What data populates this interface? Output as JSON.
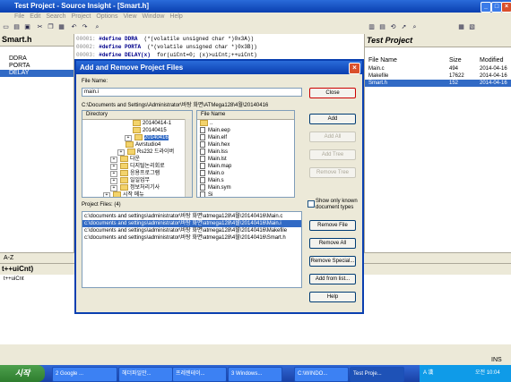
{
  "window": {
    "title": "Test Project - Source Insight - [Smart.h]"
  },
  "menu": [
    "File",
    "Edit",
    "Search",
    "Project",
    "Options",
    "View",
    "Window",
    "Help"
  ],
  "left_pane": {
    "title": "Smart.h",
    "symbols": [
      "DDRA",
      "PORTA",
      "DELAY"
    ],
    "selected": 2
  },
  "editor": {
    "lines": [
      {
        "num": "00001:",
        "kw": "#define",
        "name": "DDRA",
        "rest": "(*(volatile unsigned char *)0x3A))"
      },
      {
        "num": "00002:",
        "kw": "#define",
        "name": "PORTA",
        "rest": "(*(volatile unsigned char *)0x3B))"
      },
      {
        "num": "00003:",
        "kw": "#define",
        "name": "DELAY(x)",
        "rest": "for(uiCnt=0; (x)>uiCnt;++uiCnt)"
      }
    ]
  },
  "project_pane": {
    "title": "Test Project",
    "columns": [
      "File Name",
      "Size",
      "Modified"
    ],
    "files": [
      {
        "name": "Main.c",
        "size": "494",
        "modified": "2014-04-16"
      },
      {
        "name": "Makefile",
        "size": "17622",
        "modified": "2014-04-16"
      },
      {
        "name": "Smart.h",
        "size": "152",
        "modified": "2014-04-16"
      }
    ],
    "selected": 2
  },
  "context": {
    "tab_label": "A-Z",
    "title": "t++uiCnt)",
    "content": "t++uiCnt"
  },
  "status": {
    "mode": "INS"
  },
  "dialog": {
    "title": "Add and Remove Project Files",
    "file_name_label": "File Name:",
    "file_name_value": "main.i",
    "path": "C:\\Documents and Settings\\Administrator\\바탕 화면\\ATMega128\\4월\\20140416",
    "directory_header": "Directory",
    "directories": [
      {
        "label": "20140414-1",
        "indent": 56,
        "expand": ""
      },
      {
        "label": "20140415",
        "indent": 56,
        "expand": ""
      },
      {
        "label": "20140416",
        "indent": 56,
        "expand": "+"
      },
      {
        "label": "Avrstudio4",
        "indent": 48,
        "expand": ""
      },
      {
        "label": "Rs232 드라이버",
        "indent": 48,
        "expand": "+"
      },
      {
        "label": "다운",
        "indent": 40,
        "expand": "+"
      },
      {
        "label": "디지털논리회로",
        "indent": 40,
        "expand": "+"
      },
      {
        "label": "응용프로그램",
        "indent": 40,
        "expand": "+"
      },
      {
        "label": "일일업무",
        "indent": 40,
        "expand": "+"
      },
      {
        "label": "정보처리기사",
        "indent": 40,
        "expand": "+"
      },
      {
        "label": "시작 메뉴",
        "indent": 32,
        "expand": "+"
      }
    ],
    "directory_selected": 2,
    "file_header": "File Name",
    "files": [
      "..",
      "Main.eep",
      "Main.elf",
      "Main.hex",
      "Main.lss",
      "Main.lst",
      "Main.map",
      "Main.o",
      "Main.s",
      "Main.sym",
      "Si"
    ],
    "project_files_label": "Project Files: (4)",
    "project_files": [
      "c:\\documents and settings\\administrator\\바탕 화면\\atmega128\\4월\\20140416\\Main.c",
      "c:\\documents and settings\\administrator\\바탕 화면\\atmega128\\4월\\20140416\\Main.i",
      "c:\\documents and settings\\administrator\\바탕 화면\\atmega128\\4월\\20140416\\Makefile",
      "c:\\documents and settings\\administrator\\바탕 화면\\atmega128\\4월\\20140416\\Smart.h"
    ],
    "project_file_selected": 1,
    "show_only_known_label": "Show only known document types",
    "buttons": {
      "close": "Close",
      "add": "Add",
      "add_all": "Add All",
      "add_tree": "Add Tree",
      "remove_tree": "Remove Tree",
      "remove_file": "Remove File",
      "remove_all": "Remove All",
      "remove_special": "Remove Special...",
      "add_from_list": "Add from list...",
      "help": "Help"
    }
  },
  "taskbar": {
    "start": "시작",
    "tasks": [
      "2 Google ...",
      "헤더파일만...",
      "프레젠테이...",
      "3 Windows...",
      "C:\\WINDO...",
      "Test Proje..."
    ],
    "active": 5,
    "ime": "A 漢",
    "clock": "오전 10:04"
  },
  "colors": {
    "accent": "#0a3fb0",
    "selection": "#316ac5",
    "taskbar": "#245edb"
  }
}
